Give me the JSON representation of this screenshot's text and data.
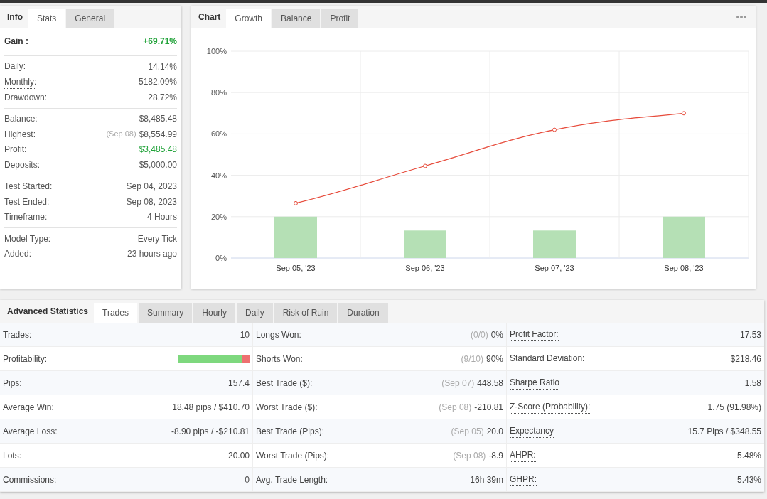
{
  "info_panel": {
    "title": "Info",
    "tabs": [
      {
        "label": "Stats",
        "selected": true
      },
      {
        "label": "General",
        "selected": false
      }
    ],
    "groups": [
      {
        "rows": [
          {
            "label": "Gain :",
            "value": "+69.71%",
            "tooltip": true,
            "positive": true,
            "kind": "headline"
          }
        ]
      },
      {
        "rows": [
          {
            "label": "Daily:",
            "value": "14.14%",
            "tooltip": true,
            "positive": false,
            "kind": "plain"
          },
          {
            "label": "Monthly:",
            "value": "5182.09%",
            "tooltip": true,
            "positive": false,
            "kind": "plain"
          },
          {
            "label": "Drawdown:",
            "value": "28.72%",
            "tooltip": false,
            "positive": false,
            "kind": "plain"
          }
        ]
      },
      {
        "rows": [
          {
            "label": "Balance:",
            "value": "$8,485.48",
            "tooltip": false,
            "positive": false,
            "kind": "plain"
          },
          {
            "label": "Highest:",
            "note": "(Sep 08)",
            "value": "$8,554.99",
            "tooltip": false,
            "positive": false,
            "kind": "plain"
          },
          {
            "label": "Profit:",
            "value": "$3,485.48",
            "tooltip": false,
            "positive": true,
            "kind": "plain"
          },
          {
            "label": "Deposits:",
            "value": "$5,000.00",
            "tooltip": false,
            "positive": false,
            "kind": "plain"
          }
        ]
      },
      {
        "rows": [
          {
            "label": "Test Started:",
            "value": "Sep 04, 2023",
            "tooltip": false,
            "positive": false,
            "kind": "plain"
          },
          {
            "label": "Test Ended:",
            "value": "Sep 08, 2023",
            "tooltip": false,
            "positive": false,
            "kind": "plain"
          },
          {
            "label": "Timeframe:",
            "value": "4 Hours",
            "tooltip": false,
            "positive": false,
            "kind": "plain"
          }
        ]
      },
      {
        "rows": [
          {
            "label": "Model Type:",
            "value": "Every Tick",
            "tooltip": false,
            "positive": false,
            "kind": "plain"
          },
          {
            "label": "Added:",
            "value": "23 hours ago",
            "tooltip": false,
            "positive": false,
            "kind": "plain"
          }
        ]
      }
    ]
  },
  "chart_panel": {
    "title": "Chart",
    "tabs": [
      {
        "label": "Growth",
        "selected": true
      },
      {
        "label": "Balance",
        "selected": false
      },
      {
        "label": "Profit",
        "selected": false
      }
    ],
    "chart_data": {
      "type": "line",
      "categories": [
        "Sep 05, '23",
        "Sep 06, '23",
        "Sep 07, '23",
        "Sep 08, '23"
      ],
      "ylim": [
        0,
        100
      ],
      "yticks": [
        {
          "value": 0,
          "label": "0%"
        },
        {
          "value": 20,
          "label": "20%"
        },
        {
          "value": 40,
          "label": "40%"
        },
        {
          "value": 60,
          "label": "60%"
        },
        {
          "value": 80,
          "label": "80%"
        },
        {
          "value": 100,
          "label": "100%"
        }
      ],
      "grid": true,
      "series": [
        {
          "color": "#e74c3c",
          "marker": true,
          "values": [
            26.5,
            44.5,
            62,
            70
          ]
        },
        {
          "type": "bar",
          "color": "#b5e0b5",
          "values": [
            20,
            13.3,
            13.3,
            20
          ]
        }
      ]
    }
  },
  "advanced_panel": {
    "title": "Advanced Statistics",
    "tabs": [
      {
        "label": "Trades",
        "selected": true
      },
      {
        "label": "Summary",
        "selected": false
      },
      {
        "label": "Hourly",
        "selected": false
      },
      {
        "label": "Daily",
        "selected": false
      },
      {
        "label": "Risk of Ruin",
        "selected": false
      },
      {
        "label": "Duration",
        "selected": false
      }
    ],
    "columns": [
      {
        "items": [
          {
            "label": "Trades:",
            "value": "10",
            "tooltip": false,
            "kind": "text"
          },
          {
            "label": "Profitability:",
            "level": 0.9,
            "tooltip": false,
            "kind": "bar"
          },
          {
            "label": "Pips:",
            "value": "157.4",
            "tooltip": false,
            "kind": "text"
          },
          {
            "label": "Average Win:",
            "value": "18.48 pips / $410.70",
            "tooltip": false,
            "kind": "text"
          },
          {
            "label": "Average Loss:",
            "value": "-8.90 pips / -$210.81",
            "tooltip": false,
            "kind": "text"
          },
          {
            "label": "Lots:",
            "value": "20.00",
            "tooltip": false,
            "kind": "text"
          },
          {
            "label": "Commissions:",
            "value": "0",
            "tooltip": false,
            "kind": "text"
          }
        ]
      },
      {
        "items": [
          {
            "label": "Longs Won:",
            "note": "(0/0)",
            "value": "0%",
            "tooltip": false,
            "kind": "text"
          },
          {
            "label": "Shorts Won:",
            "note": "(9/10)",
            "value": "90%",
            "tooltip": false,
            "kind": "text"
          },
          {
            "label": "Best Trade ($):",
            "note": "(Sep 07)",
            "value": "448.58",
            "tooltip": false,
            "kind": "text"
          },
          {
            "label": "Worst Trade ($):",
            "note": "(Sep 08)",
            "value": "-210.81",
            "tooltip": false,
            "kind": "text"
          },
          {
            "label": "Best Trade (Pips):",
            "note": "(Sep 05)",
            "value": "20.0",
            "tooltip": false,
            "kind": "text"
          },
          {
            "label": "Worst Trade (Pips):",
            "note": "(Sep 08)",
            "value": "-8.9",
            "tooltip": false,
            "kind": "text"
          },
          {
            "label": "Avg. Trade Length:",
            "value": "16h 39m",
            "tooltip": false,
            "kind": "text"
          }
        ]
      },
      {
        "items": [
          {
            "label": "Profit Factor:",
            "value": "17.53",
            "tooltip": true,
            "kind": "text"
          },
          {
            "label": "Standard Deviation:",
            "value": "$218.46",
            "tooltip": true,
            "kind": "text"
          },
          {
            "label": "Sharpe Ratio",
            "value": "1.58",
            "tooltip": true,
            "kind": "text"
          },
          {
            "label": "Z-Score (Probability):",
            "value": "1.75 (91.98%)",
            "tooltip": true,
            "kind": "text"
          },
          {
            "label": "Expectancy",
            "value": "15.7 Pips / $348.55",
            "tooltip": true,
            "kind": "text"
          },
          {
            "label": "AHPR:",
            "value": "5.48%",
            "tooltip": true,
            "kind": "text"
          },
          {
            "label": "GHPR:",
            "value": "5.43%",
            "tooltip": true,
            "kind": "text"
          }
        ]
      }
    ]
  }
}
